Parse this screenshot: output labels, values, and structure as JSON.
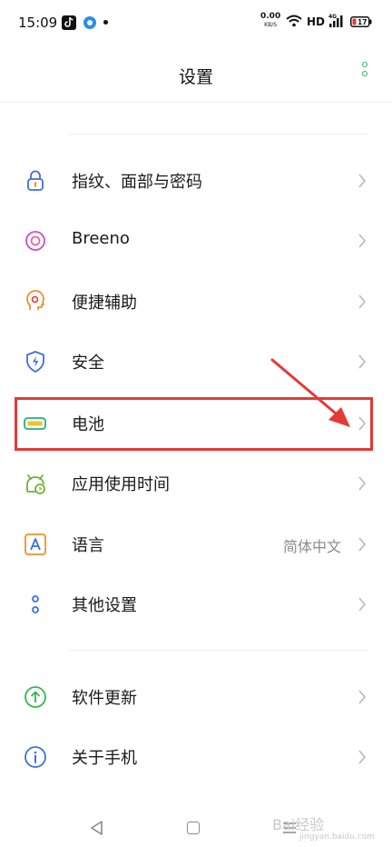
{
  "status_bar": {
    "time": "15:09",
    "net_speed": "0.00",
    "net_unit": "KB/S",
    "network_type": "HD",
    "battery_level": "17"
  },
  "header": {
    "title": "设置"
  },
  "settings": {
    "items": [
      {
        "label": "指纹、面部与密码",
        "icon": "lock-icon",
        "color": "#3d6fe0"
      },
      {
        "label": "Breeno",
        "icon": "breeno-icon",
        "color": "#c74fd6"
      },
      {
        "label": "便捷辅助",
        "icon": "assistant-icon",
        "color": "#f0902a"
      },
      {
        "label": "安全",
        "icon": "shield-icon",
        "color": "#3d6fe0"
      },
      {
        "label": "电池",
        "icon": "battery-icon",
        "color": "#22b37a"
      },
      {
        "label": "应用使用时间",
        "icon": "app-timer-icon",
        "color": "#6bb536"
      },
      {
        "label": "语言",
        "icon": "language-icon",
        "color": "#f0902a",
        "value": "简体中文"
      },
      {
        "label": "其他设置",
        "icon": "more-settings-icon",
        "color": "#3d6fe0"
      },
      {
        "label": "软件更新",
        "icon": "update-icon",
        "color": "#2db84d"
      },
      {
        "label": "关于手机",
        "icon": "info-icon",
        "color": "#3d6fe0"
      }
    ]
  },
  "annotation": {
    "highlight_color": "#e53935"
  },
  "watermark": {
    "text": "Bai经验",
    "sub": "jingyan.baidu.com"
  }
}
